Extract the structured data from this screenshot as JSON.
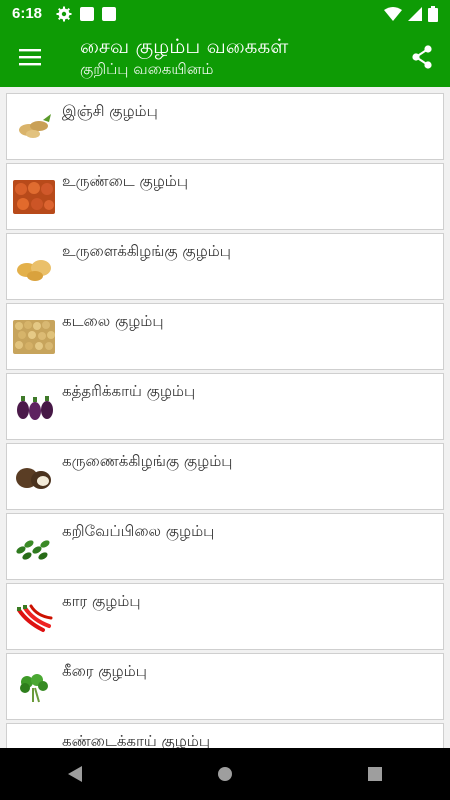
{
  "status": {
    "time": "6:18"
  },
  "app_bar": {
    "title": "சைவ குழம்ப வகைகள்",
    "subtitle": "குறிப்பு வகையினம்",
    "menu_icon": "hamburger-menu-icon",
    "share_icon": "share-icon"
  },
  "colors": {
    "primary": "#0e9b05",
    "card_bg": "#ffffff",
    "list_bg": "#f1f1f1"
  },
  "recipes": [
    {
      "label": "இஞ்சி குழம்பு",
      "icon": "ginger-image"
    },
    {
      "label": "உருண்டை குழம்பு",
      "icon": "kofta-balls-image"
    },
    {
      "label": "உருளைக்கிழங்கு குழம்பு",
      "icon": "potato-image"
    },
    {
      "label": "கடலை குழம்பு",
      "icon": "chickpea-image"
    },
    {
      "label": "கத்தரிக்காய் குழம்பு",
      "icon": "brinjal-image"
    },
    {
      "label": "கருணைக்கிழங்கு குழம்பு",
      "icon": "yam-image"
    },
    {
      "label": "கறிவேப்பிலை குழம்பு",
      "icon": "curry-leaves-image"
    },
    {
      "label": "கார குழம்பு",
      "icon": "red-chilli-image"
    },
    {
      "label": "கீரை குழம்பு",
      "icon": "greens-image"
    },
    {
      "label": "கண்டைக்காய் குழம்பு",
      "icon": "gourd-image"
    }
  ]
}
